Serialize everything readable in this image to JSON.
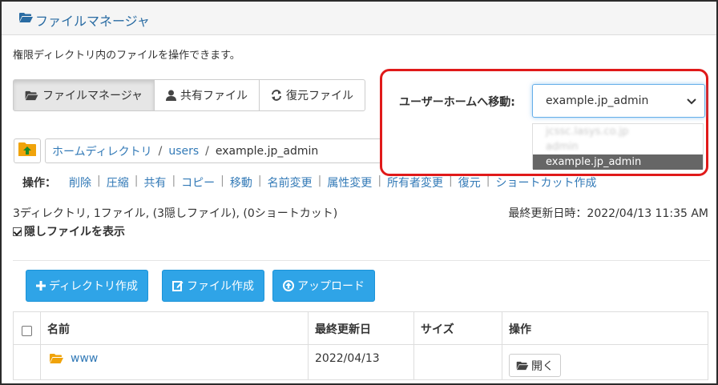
{
  "header": {
    "title": "ファイルマネージャ",
    "icon": "folder-open-icon"
  },
  "description": "権限ディレクトリ内のファイルを操作できます。",
  "tabs": [
    {
      "label": "ファイルマネージャ",
      "icon": "folder-open-icon",
      "active": true
    },
    {
      "label": "共有ファイル",
      "icon": "user-icon"
    },
    {
      "label": "復元ファイル",
      "icon": "refresh-icon"
    }
  ],
  "destination": {
    "label": "ユーザーホームへ移動:",
    "selected": "example.jp_admin",
    "options": [
      {
        "label": "jcssc.lasys.co.jp",
        "blurred": true
      },
      {
        "label": "admin",
        "blurred": true
      },
      {
        "label": "example.jp_admin",
        "selected": true
      }
    ]
  },
  "breadcrumb": {
    "items": [
      "ホームディレクトリ",
      "users"
    ],
    "current": "example.jp_admin",
    "separator": "/"
  },
  "operations": {
    "label": "操作：",
    "items": [
      "削除",
      "圧縮",
      "共有",
      "コピー",
      "移動",
      "名前変更",
      "属性変更",
      "所有者変更",
      "復元",
      "ショートカット作成"
    ]
  },
  "summary": "3ディレクトリ, 1ファイル, (3隠しファイル), (0ショートカット)",
  "last_modified": "最終更新日時：2022/04/13 11:35 AM",
  "show_hidden": {
    "label": "隠しファイルを表示",
    "checked": true
  },
  "actions": {
    "create_dir": "ディレクトリ作成",
    "create_file": "ファイル作成",
    "upload": "アップロード"
  },
  "table": {
    "headers": {
      "name": "名前",
      "modified": "最終更新日",
      "size": "サイズ",
      "ops": "操作"
    },
    "rows": [
      {
        "name": "www",
        "modified": "2022/04/13",
        "size": "",
        "action": "開く"
      }
    ]
  },
  "colors": {
    "primary": "#2fa4e7",
    "highlight": "#e01a1a",
    "link": "#337ab7",
    "folder": "#f0a30a"
  }
}
